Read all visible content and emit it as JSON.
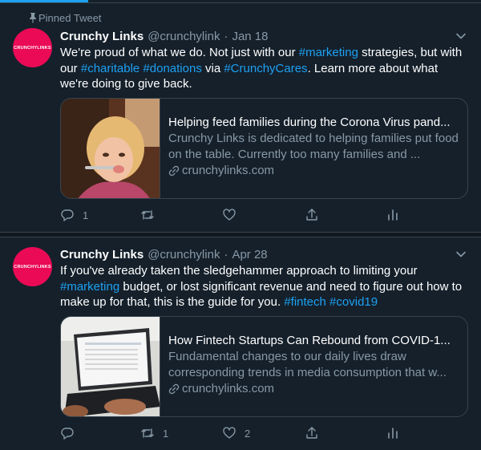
{
  "pinned_label": "Pinned Tweet",
  "colors": {
    "background": "#15202b",
    "accent": "#1da1f2",
    "avatar": "#ea0a55",
    "muted": "#8899a6"
  },
  "tweets": [
    {
      "name": "Crunchy Links",
      "handle": "@crunchylink",
      "dot": "·",
      "date": "Jan 18",
      "avatar_text": "CRUNCHYLINKS",
      "text": {
        "p1": "We're proud of what we do. Not just with our ",
        "tag1": "#marketing",
        "p2": " strategies, but with our ",
        "tag2": "#charitable",
        "p3": " ",
        "tag3": "#donations",
        "p4": " via ",
        "tag4": "#CrunchyCares",
        "p5": ". Learn more about what we're doing to give back."
      },
      "card": {
        "title": "Helping feed families during the Corona Virus pand...",
        "description": "Crunchy Links is dedicated to helping families put food on the table. Currently too many families and ...",
        "domain": "crunchylinks.com"
      },
      "actions": {
        "reply_count": "1",
        "retweet_count": "",
        "like_count": ""
      }
    },
    {
      "name": "Crunchy Links",
      "handle": "@crunchylink",
      "dot": "·",
      "date": "Apr 28",
      "avatar_text": "CRUNCHYLINKS",
      "text": {
        "p1": "If you've already taken the sledgehammer approach to limiting your ",
        "tag1": "#marketing",
        "p2": " budget, or lost significant revenue and need to figure out how to make up for that, this is the guide for you. ",
        "tag2": "#fintech",
        "p3": " ",
        "tag3": "#covid19",
        "p4": "",
        "tag4": "",
        "p5": ""
      },
      "card": {
        "title": "How Fintech Startups Can Rebound from COVID-1...",
        "description": "Fundamental changes to our daily lives draw corresponding trends in media consumption that w...",
        "domain": "crunchylinks.com"
      },
      "actions": {
        "reply_count": "",
        "retweet_count": "1",
        "like_count": "2"
      }
    }
  ]
}
